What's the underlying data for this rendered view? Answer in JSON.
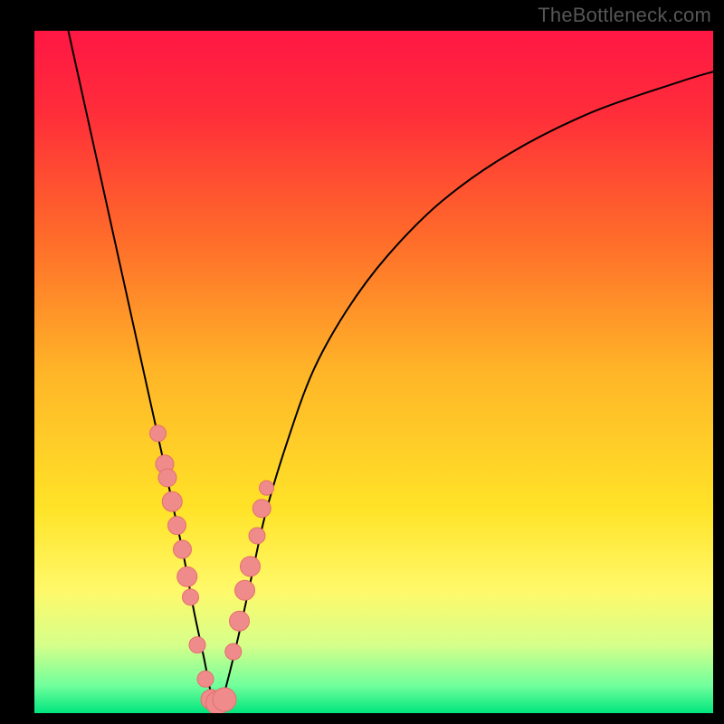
{
  "watermark": {
    "text": "TheBottleneck.com"
  },
  "chart_data": {
    "type": "line",
    "title": "",
    "xlabel": "",
    "ylabel": "",
    "xlim": [
      0,
      100
    ],
    "ylim": [
      0,
      100
    ],
    "grid": false,
    "legend": false,
    "background_gradient": {
      "stops": [
        {
          "offset": 0.0,
          "color": "#ff1744"
        },
        {
          "offset": 0.12,
          "color": "#ff2d3a"
        },
        {
          "offset": 0.3,
          "color": "#ff6a2a"
        },
        {
          "offset": 0.5,
          "color": "#ffb528"
        },
        {
          "offset": 0.7,
          "color": "#ffe328"
        },
        {
          "offset": 0.82,
          "color": "#fff96a"
        },
        {
          "offset": 0.9,
          "color": "#d6ff8a"
        },
        {
          "offset": 0.96,
          "color": "#70ff9c"
        },
        {
          "offset": 1.0,
          "color": "#00e57e"
        }
      ]
    },
    "series": [
      {
        "name": "curve",
        "color": "#000000",
        "stroke_width": 2,
        "x": [
          5,
          7,
          9,
          11,
          13,
          15,
          17,
          19,
          20.5,
          22,
          23.5,
          25,
          26,
          27,
          28,
          30,
          32,
          34,
          37,
          41,
          46,
          52,
          60,
          70,
          82,
          95,
          100
        ],
        "y": [
          100,
          91,
          82,
          73,
          64,
          55,
          46,
          37,
          30,
          23,
          15,
          8,
          3,
          0,
          3,
          11,
          20,
          29,
          39,
          50,
          59,
          67,
          75,
          82,
          88,
          92.5,
          94
        ]
      }
    ],
    "points": [
      {
        "name": "pink-dots",
        "color": "#ef8b8b",
        "stroke": "#e46f6f",
        "x": [
          18.2,
          19.2,
          19.6,
          20.3,
          21.0,
          21.8,
          22.5,
          23.0,
          24.0,
          25.2,
          26.0,
          27.0,
          28.0,
          29.3,
          30.2,
          31.0,
          31.8,
          32.8,
          33.5,
          34.2
        ],
        "y": [
          41.0,
          36.5,
          34.5,
          31.0,
          27.5,
          24.0,
          20.0,
          17.0,
          10.0,
          5.0,
          2.0,
          1.5,
          2.0,
          9.0,
          13.5,
          18.0,
          21.5,
          26.0,
          30.0,
          33.0
        ],
        "r": [
          9,
          10,
          10,
          11,
          10,
          10,
          11,
          9,
          9,
          9,
          11,
          13,
          13,
          9,
          11,
          11,
          11,
          9,
          10,
          8
        ]
      }
    ]
  }
}
